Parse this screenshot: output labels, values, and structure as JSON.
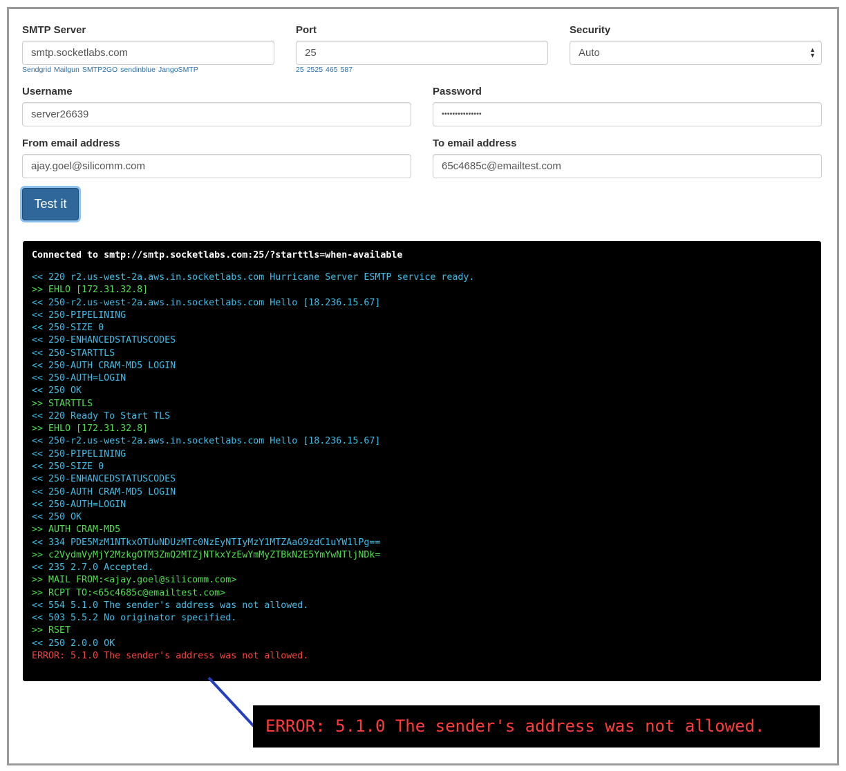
{
  "form": {
    "smtp_server": {
      "label": "SMTP Server",
      "value": "smtp.socketlabs.com",
      "suggestions": [
        "Sendgrid",
        "Mailgun",
        "SMTP2GO",
        "sendinblue",
        "JangoSMTP"
      ]
    },
    "port": {
      "label": "Port",
      "value": "25",
      "suggestions": [
        "25",
        "2525",
        "465",
        "587"
      ]
    },
    "security": {
      "label": "Security",
      "value": "Auto"
    },
    "username": {
      "label": "Username",
      "value": "server26639"
    },
    "password": {
      "label": "Password",
      "value": "•••••••••••••••"
    },
    "from_email": {
      "label": "From email address",
      "value": "ajay.goel@silicomm.com"
    },
    "to_email": {
      "label": "To email address",
      "value": "65c4685c@emailtest.com"
    },
    "submit_label": "Test it"
  },
  "terminal": {
    "connected": "Connected to smtp://smtp.socketlabs.com:25/?starttls=when-available",
    "lines": [
      {
        "dir": "in",
        "text": "<< 220 r2.us-west-2a.aws.in.socketlabs.com Hurricane Server ESMTP service ready."
      },
      {
        "dir": "out",
        "text": ">> EHLO [172.31.32.8]"
      },
      {
        "dir": "in",
        "text": "<< 250-r2.us-west-2a.aws.in.socketlabs.com Hello [18.236.15.67]"
      },
      {
        "dir": "in",
        "text": "<< 250-PIPELINING"
      },
      {
        "dir": "in",
        "text": "<< 250-SIZE 0"
      },
      {
        "dir": "in",
        "text": "<< 250-ENHANCEDSTATUSCODES"
      },
      {
        "dir": "in",
        "text": "<< 250-STARTTLS"
      },
      {
        "dir": "in",
        "text": "<< 250-AUTH CRAM-MD5 LOGIN"
      },
      {
        "dir": "in",
        "text": "<< 250-AUTH=LOGIN"
      },
      {
        "dir": "in",
        "text": "<< 250 OK"
      },
      {
        "dir": "out",
        "text": ">> STARTTLS"
      },
      {
        "dir": "in",
        "text": "<< 220 Ready To Start TLS"
      },
      {
        "dir": "out",
        "text": ">> EHLO [172.31.32.8]"
      },
      {
        "dir": "in",
        "text": "<< 250-r2.us-west-2a.aws.in.socketlabs.com Hello [18.236.15.67]"
      },
      {
        "dir": "in",
        "text": "<< 250-PIPELINING"
      },
      {
        "dir": "in",
        "text": "<< 250-SIZE 0"
      },
      {
        "dir": "in",
        "text": "<< 250-ENHANCEDSTATUSCODES"
      },
      {
        "dir": "in",
        "text": "<< 250-AUTH CRAM-MD5 LOGIN"
      },
      {
        "dir": "in",
        "text": "<< 250-AUTH=LOGIN"
      },
      {
        "dir": "in",
        "text": "<< 250 OK"
      },
      {
        "dir": "out",
        "text": ">> AUTH CRAM-MD5"
      },
      {
        "dir": "in",
        "text": "<< 334 PDE5MzM1NTkxOTUuNDUzMTc0NzEyNTIyMzY1MTZAaG9zdC1uYW1lPg=="
      },
      {
        "dir": "out",
        "text": ">> c2VydmVyMjY2MzkgOTM3ZmQ2MTZjNTkxYzEwYmMyZTBkN2E5YmYwNTljNDk="
      },
      {
        "dir": "in",
        "text": "<< 235 2.7.0 Accepted."
      },
      {
        "dir": "out",
        "text": ">> MAIL FROM:<ajay.goel@silicomm.com>"
      },
      {
        "dir": "out",
        "text": ">> RCPT TO:<65c4685c@emailtest.com>"
      },
      {
        "dir": "in",
        "text": "<< 554 5.1.0 The sender's address was not allowed."
      },
      {
        "dir": "in",
        "text": "<< 503 5.5.2 No originator specified."
      },
      {
        "dir": "out",
        "text": ">> RSET"
      },
      {
        "dir": "in",
        "text": "<< 250 2.0.0 OK"
      },
      {
        "dir": "err",
        "text": "ERROR: 5.1.0 The sender's address was not allowed."
      }
    ]
  },
  "callout": {
    "text": "ERROR: 5.1.0 The sender's address was not allowed."
  },
  "colors": {
    "incoming": "#3bbfe8",
    "outgoing": "#4ce04c",
    "error": "#ff4040",
    "button": "#2f679a",
    "pointer": "#2440c0"
  }
}
